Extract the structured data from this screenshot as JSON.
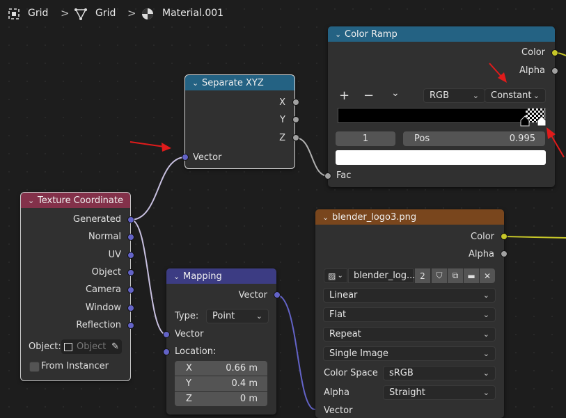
{
  "breadcrumb": {
    "object": "Grid",
    "mesh": "Grid",
    "material": "Material.001",
    "separator": ">"
  },
  "color_ramp": {
    "title": "Color Ramp",
    "outputs": [
      "Color",
      "Alpha"
    ],
    "add": "+",
    "remove": "−",
    "menu": "⌄",
    "color_mode": "RGB",
    "interpolation": "Constant",
    "stop_index": "1",
    "pos_label": "Pos",
    "pos_value": "0.995",
    "input": "Fac",
    "active_color": "#ffffff"
  },
  "separate_xyz": {
    "title": "Separate XYZ",
    "outputs": [
      "X",
      "Y",
      "Z"
    ],
    "input": "Vector"
  },
  "texture_coordinate": {
    "title": "Texture Coordinate",
    "outputs": [
      "Generated",
      "Normal",
      "UV",
      "Object",
      "Camera",
      "Window",
      "Reflection"
    ],
    "object_label": "Object:",
    "object_placeholder": "Object",
    "from_instancer": "From Instancer"
  },
  "mapping": {
    "title": "Mapping",
    "output": "Vector",
    "type_label": "Type:",
    "type_value": "Point",
    "input_vector": "Vector",
    "location_label": "Location:",
    "location": [
      {
        "axis": "X",
        "value": "0.66 m"
      },
      {
        "axis": "Y",
        "value": "0.4 m"
      },
      {
        "axis": "Z",
        "value": "0 m"
      }
    ]
  },
  "image_texture": {
    "title": "blender_logo3.png",
    "outputs": [
      "Color",
      "Alpha"
    ],
    "image_name": "blender_log...",
    "users": "2",
    "interpolation": "Linear",
    "projection": "Flat",
    "extension": "Repeat",
    "source": "Single Image",
    "color_space_label": "Color Space",
    "color_space": "sRGB",
    "alpha_label": "Alpha",
    "alpha": "Straight",
    "input_vector": "Vector"
  },
  "colors": {
    "header_converter": "#246283",
    "header_input": "#83314a",
    "header_vector": "#3c3c83",
    "header_texture": "#79461d",
    "annotation_arrow": "#e01b1b"
  }
}
